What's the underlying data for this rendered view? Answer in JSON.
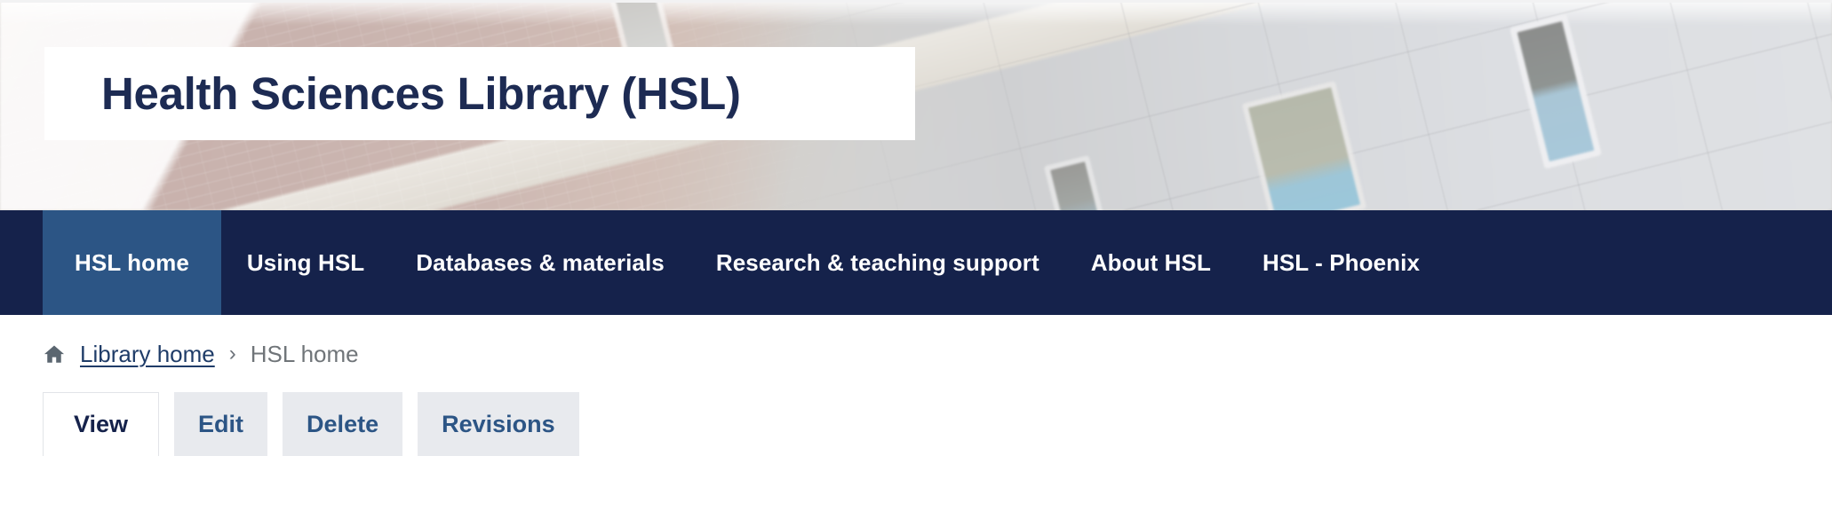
{
  "hero": {
    "title": "Health Sciences Library (HSL)",
    "image_alt": "building-facade-photo"
  },
  "main_nav": {
    "items": [
      {
        "label": "HSL home",
        "active": true
      },
      {
        "label": "Using HSL",
        "active": false
      },
      {
        "label": "Databases & materials",
        "active": false
      },
      {
        "label": "Research & teaching support",
        "active": false
      },
      {
        "label": "About HSL",
        "active": false
      },
      {
        "label": "HSL - Phoenix",
        "active": false
      }
    ]
  },
  "breadcrumb": {
    "home_icon": "home-icon",
    "link_label": "Library home",
    "separator": "›",
    "current": "HSL home"
  },
  "task_tabs": {
    "items": [
      {
        "label": "View",
        "active": true
      },
      {
        "label": "Edit",
        "active": false
      },
      {
        "label": "Delete",
        "active": false
      },
      {
        "label": "Revisions",
        "active": false
      }
    ]
  },
  "colors": {
    "nav_background": "#15224b",
    "nav_active": "#2c5585",
    "title_text": "#1d2b53",
    "link_blue": "#2c5585",
    "tab_inactive_bg": "#e8eaee",
    "breadcrumb_current": "#707579",
    "home_icon": "#5b6670"
  }
}
